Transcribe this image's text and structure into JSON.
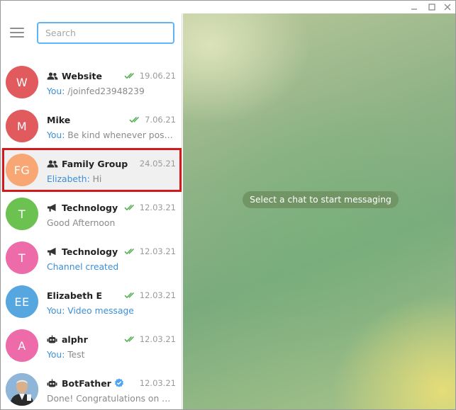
{
  "search": {
    "placeholder": "Search"
  },
  "main": {
    "empty_text": "Select a chat to start messaging"
  },
  "colors": {
    "accent": "#3a8fd6",
    "check": "#4fae4e",
    "highlight_border": "#d2191c"
  },
  "chats": [
    {
      "initials": "W",
      "avatar_color": "#e05a5e",
      "type_icon": "group-icon",
      "name": "Website",
      "check": "double-check-icon",
      "date": "19.06.21",
      "sender": "You: ",
      "preview": "/joinfed23948239",
      "service": false
    },
    {
      "initials": "M",
      "avatar_color": "#e05a5e",
      "type_icon": "",
      "name": "Mike",
      "check": "double-check-icon",
      "date": "7.06.21",
      "sender": "You: ",
      "preview": "Be kind whenever possible",
      "service": false
    },
    {
      "initials": "FG",
      "avatar_color": "#f7a674",
      "type_icon": "group-icon",
      "name": "Family Group",
      "check": "",
      "date": "24.05.21",
      "sender": "Elizabeth: ",
      "preview": "Hi",
      "service": false,
      "selected": true
    },
    {
      "initials": "T",
      "avatar_color": "#6cc251",
      "type_icon": "megaphone-icon",
      "name": "Technology",
      "check": "double-check-icon",
      "date": "12.03.21",
      "sender": "",
      "preview": "Good Afternoon",
      "service": false
    },
    {
      "initials": "T",
      "avatar_color": "#ec6ba8",
      "type_icon": "megaphone-icon",
      "name": "Technology",
      "check": "double-check-icon",
      "date": "12.03.21",
      "sender": "",
      "preview": "Channel created",
      "service": true
    },
    {
      "initials": "EE",
      "avatar_color": "#56a6e0",
      "type_icon": "",
      "name": "Elizabeth E",
      "check": "double-check-icon",
      "date": "12.03.21",
      "sender": "You: ",
      "preview": "Video message",
      "service": true
    },
    {
      "initials": "A",
      "avatar_color": "#ec6ba8",
      "type_icon": "bot-icon",
      "name": "alphr",
      "check": "double-check-icon",
      "date": "12.03.21",
      "sender": "You: ",
      "preview": "Test",
      "service": false
    },
    {
      "initials": "",
      "avatar_color": "#4f8ab8",
      "type_icon": "bot-icon",
      "name": "BotFather",
      "check": "",
      "date": "12.03.21",
      "sender": "",
      "preview": "Done! Congratulations on your new bot.",
      "service": false,
      "verified": true,
      "photo": true
    }
  ]
}
